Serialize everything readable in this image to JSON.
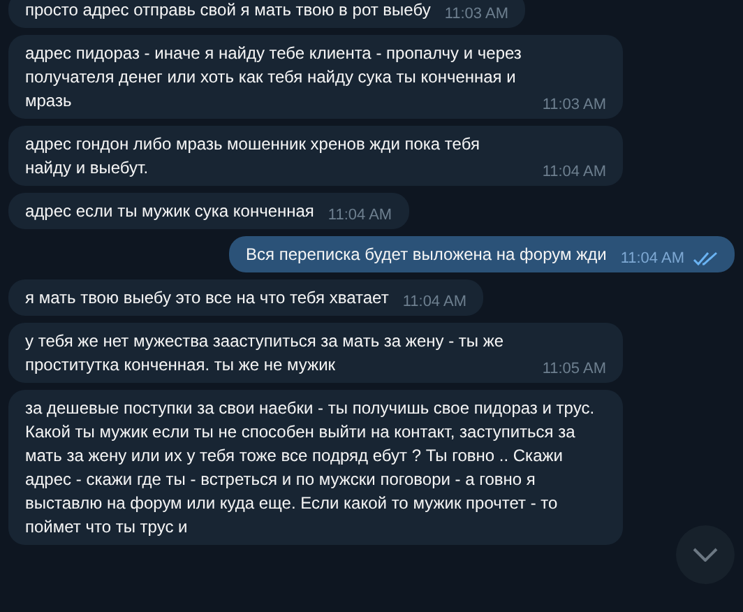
{
  "messages": [
    {
      "kind": "incoming",
      "text": "просто адрес отправь свой я мать твою в рот выебу",
      "time": "11:03 AM"
    },
    {
      "kind": "incoming",
      "text": "адрес пидораз - иначе я найду тебе клиента - пропалчу и через получателя денег или хоть как тебя найду сука ты конченная и мразь",
      "time": "11:03 AM"
    },
    {
      "kind": "incoming",
      "text": "адрес гондон либо мразь мошенник хренов жди пока тебя найду и выебут.",
      "time": "11:04 AM"
    },
    {
      "kind": "incoming",
      "text": "адрес если ты мужик сука конченная",
      "time": "11:04 AM"
    },
    {
      "kind": "outgoing",
      "text": "Вся переписка будет выложена на форум жди",
      "time": "11:04 AM",
      "read": true
    },
    {
      "kind": "incoming",
      "text": "я мать твою выебу это все на что тебя хватает",
      "time": "11:04 AM"
    },
    {
      "kind": "incoming",
      "text": "у тебя же нет мужества зааступиться за мать за жену - ты же проститутка конченная. ты же не мужик",
      "time": "11:05 AM"
    },
    {
      "kind": "incoming",
      "text": "за дешевые поступки за свои наебки - ты получишь свое пидораз и трус. Какой ты мужик если ты не способен выйти на контакт, заступиться за мать за жену или их у тебя тоже все подряд ебут ? Ты говно .. Скажи адрес - скажи где ты - встреться и по мужски поговори - а говно я выставлю на форум или куда еще. Если какой то мужик прочтет - то поймет что ты трус и"
    }
  ]
}
